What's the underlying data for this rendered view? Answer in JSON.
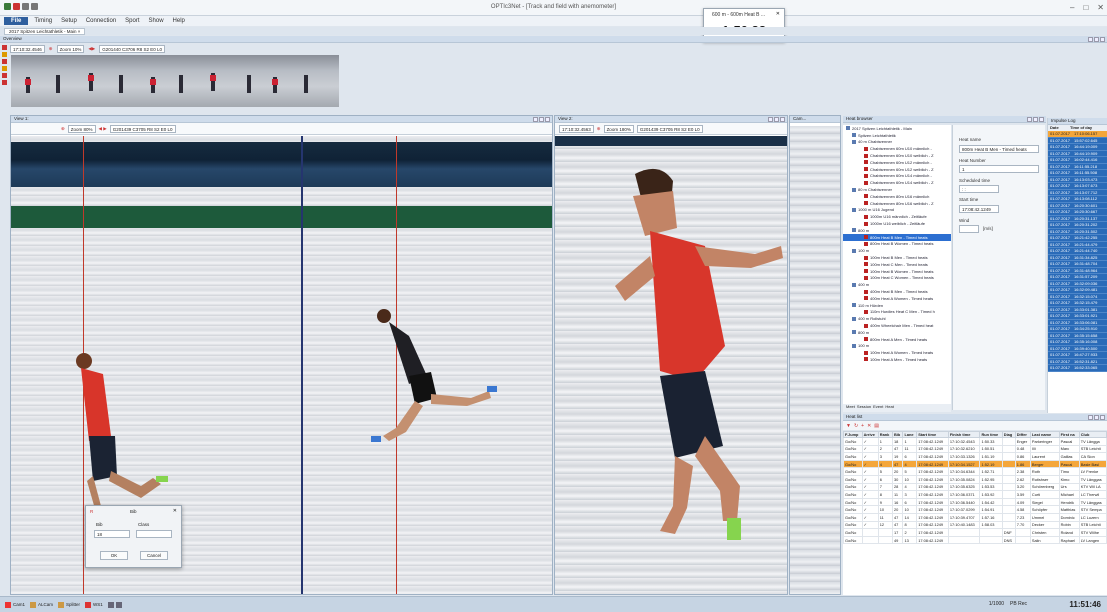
{
  "window": {
    "title": "OPTIc3Net - [Track and field with anemometer]",
    "controls": [
      "–",
      "□",
      "✕"
    ]
  },
  "menu": [
    "File",
    "Timing",
    "Setup",
    "Connection",
    "Sport",
    "Show",
    "Help"
  ],
  "countdown": {
    "title": "600 m - 600m Heat B ...",
    "close": "✕",
    "time": "1:50.33"
  },
  "doc_tab": "2017 Spitzen Leichtathletik - Main  ×",
  "overview": {
    "header": "Overview",
    "time": "17:10:32.4546",
    "zoom": "Zoom 10%",
    "code": "G201440 C3706 R8 S2 E0 L0"
  },
  "view1": {
    "header": "View 1:",
    "zoom": "Zoom 80%",
    "code": "G201439 C3705 R8 S2 E0 L0"
  },
  "view2": {
    "header": "View 2:",
    "time": "17:10:32.4563",
    "zoom": "Zoom 180%",
    "code": "G201439 C3705 R8 S2 E0 L0"
  },
  "cam_label": "Cam...",
  "heat_browser": {
    "header": "Heat browser",
    "items": [
      {
        "label": "2017 Spitzen Leichtathletik - Main",
        "indent": 0
      },
      {
        "label": "Spitzen Leichtathletik",
        "indent": 1
      },
      {
        "label": "40 m Chabisrenner",
        "indent": 1
      },
      {
        "label": "Chabisrennen 60m U10 männlich -",
        "indent": 3
      },
      {
        "label": "Chabisrennen 60m U10 weiblich - Z",
        "indent": 3
      },
      {
        "label": "Chabisrennen 60m U12 männlich -",
        "indent": 3
      },
      {
        "label": "Chabisrennen 60m U12 weiblich - Z",
        "indent": 3
      },
      {
        "label": "Chabisrennen 60m U14 männlich -",
        "indent": 3
      },
      {
        "label": "Chabisrennen 60m U14 weiblich - Z",
        "indent": 3
      },
      {
        "label": "80 m Chabisrenner",
        "indent": 1
      },
      {
        "label": "Chabisrennen 80m U16 männlich",
        "indent": 3
      },
      {
        "label": "Chabisrennen 80m U16 weiblich - Z",
        "indent": 3
      },
      {
        "label": "1000 m U16 Jugend",
        "indent": 1
      },
      {
        "label": "1000m U16 männlich - Zeitläufe",
        "indent": 3
      },
      {
        "label": "1000m U16 weiblich - Zeitläufe",
        "indent": 3
      },
      {
        "label": "800 m",
        "indent": 1
      },
      {
        "label": "800m Heat B Men - Timed heats",
        "indent": 3,
        "selected": true
      },
      {
        "label": "800m Heat B Women - Timed heats",
        "indent": 3
      },
      {
        "label": "100 m",
        "indent": 1
      },
      {
        "label": "100m Heat B Men - Timed heats",
        "indent": 3
      },
      {
        "label": "100m Heat C Men - Timed heats",
        "indent": 3
      },
      {
        "label": "100m Heat B Women - Timed heats",
        "indent": 3
      },
      {
        "label": "100m Heat C Women - Timed heats",
        "indent": 3
      },
      {
        "label": "400 m",
        "indent": 1
      },
      {
        "label": "400m Heat B Men - Timed heats",
        "indent": 3
      },
      {
        "label": "400m Heat A Women - Timed heats",
        "indent": 3
      },
      {
        "label": "110 m Hürden",
        "indent": 1
      },
      {
        "label": "110m Hurdles Heat C Men - Timed h",
        "indent": 3
      },
      {
        "label": "400 m Rollstuhl",
        "indent": 1
      },
      {
        "label": "400m Wheelchair Men - Timed heat",
        "indent": 3
      },
      {
        "label": "800 m",
        "indent": 1
      },
      {
        "label": "800m Heat A Men - Timed heats",
        "indent": 3
      },
      {
        "label": "100 m",
        "indent": 1
      },
      {
        "label": "100m Heat A Women - Timed heats",
        "indent": 3
      },
      {
        "label": "100m Heat A Men - Timed heats",
        "indent": 3
      }
    ],
    "bottom_tabs": [
      "Meet",
      "Session",
      "Event",
      "Heat"
    ]
  },
  "heat_props": {
    "heat_name_label": "Heat name",
    "heat_name": "800m Heat B Men - Timed heats",
    "heat_number_label": "Heat Number",
    "heat_number": "1",
    "scheduled_label": "Scheduled time",
    "scheduled": ": :",
    "start_label": "Start time",
    "start": "17:08:42.1249",
    "wind_label": "Wind",
    "wind_unit": "[m/s]"
  },
  "impulse_log": {
    "header": "Impulse Log",
    "col_date": "Date",
    "col_time": "Time of day",
    "rows": [
      {
        "date": "01.07.2017",
        "time": "17:10:06.157",
        "highlight": true
      },
      {
        "date": "01.07.2017",
        "time": "15:57:02.645"
      },
      {
        "date": "01.07.2017",
        "time": "16:44:19.009"
      },
      {
        "date": "01.07.2017",
        "time": "16:44:19.909"
      },
      {
        "date": "01.07.2017",
        "time": "16:02:44.416"
      },
      {
        "date": "01.07.2017",
        "time": "16:11:55.218"
      },
      {
        "date": "01.07.2017",
        "time": "16:11:55.508"
      },
      {
        "date": "01.07.2017",
        "time": "16:13:03.473"
      },
      {
        "date": "01.07.2017",
        "time": "16:13:07.673"
      },
      {
        "date": "01.07.2017",
        "time": "16:13:07.712"
      },
      {
        "date": "01.07.2017",
        "time": "16:13:08.112"
      },
      {
        "date": "01.07.2017",
        "time": "16:20:30.601"
      },
      {
        "date": "01.07.2017",
        "time": "16:20:30.667"
      },
      {
        "date": "01.07.2017",
        "time": "16:20:31.137"
      },
      {
        "date": "01.07.2017",
        "time": "16:20:31.202"
      },
      {
        "date": "01.07.2017",
        "time": "16:20:31.502"
      },
      {
        "date": "01.07.2017",
        "time": "16:21:42.255"
      },
      {
        "date": "01.07.2017",
        "time": "16:21:44.479"
      },
      {
        "date": "01.07.2017",
        "time": "16:21:44.740"
      },
      {
        "date": "01.07.2017",
        "time": "16:31:34.825"
      },
      {
        "date": "01.07.2017",
        "time": "16:31:48.704"
      },
      {
        "date": "01.07.2017",
        "time": "16:31:48.964"
      },
      {
        "date": "01.07.2017",
        "time": "16:31:57.209"
      },
      {
        "date": "01.07.2017",
        "time": "16:32:09.036"
      },
      {
        "date": "01.07.2017",
        "time": "16:32:09.481"
      },
      {
        "date": "01.07.2017",
        "time": "16:32:15.074"
      },
      {
        "date": "01.07.2017",
        "time": "16:32:15.479"
      },
      {
        "date": "01.07.2017",
        "time": "16:33:01.381"
      },
      {
        "date": "01.07.2017",
        "time": "16:33:01.921"
      },
      {
        "date": "01.07.2017",
        "time": "16:33:06.081"
      },
      {
        "date": "01.07.2017",
        "time": "16:34:25.910"
      },
      {
        "date": "01.07.2017",
        "time": "16:35:15.658"
      },
      {
        "date": "01.07.2017",
        "time": "16:35:16.008"
      },
      {
        "date": "01.07.2017",
        "time": "16:39:40.500"
      },
      {
        "date": "01.07.2017",
        "time": "16:47:27.933"
      },
      {
        "date": "01.07.2017",
        "time": "16:52:31.821"
      },
      {
        "date": "01.07.2017",
        "time": "16:52:33.065"
      }
    ]
  },
  "heat_list": {
    "header": "Heat list",
    "columns": [
      "F.Jump",
      "Arrive",
      "Rank",
      "Bib",
      "Lane",
      "Start time",
      "Finish time",
      "Run time",
      "Diag",
      "Differ",
      "Last name",
      "First na",
      "Club"
    ],
    "rows": [
      [
        "Go/No",
        "✓",
        "1",
        "18",
        "1",
        "17:08:42.1249",
        "17:10:32.4543",
        "1:50.33",
        "",
        "Enger",
        "Parkeringer",
        "Pascal",
        "TV Längga"
      ],
      [
        "Go/No",
        "✓",
        "2",
        "47",
        "11",
        "17:08:42.1249",
        "17:10:32.6210",
        "1:50.51",
        "",
        "0.48",
        "Illi",
        "Marc",
        "STB Leichti"
      ],
      [
        "Go/No",
        "✓",
        "3",
        "19",
        "6",
        "17:08:42.1249",
        "17:10:33.1326",
        "1:51.19",
        "",
        "0.86",
        "Laurent",
        "Gaillas",
        "CA Sion"
      ],
      [
        "Go/No",
        "✓",
        "4",
        "47",
        "4",
        "17:08:42.1249",
        "17:10:34.1527",
        "1:52.19",
        "",
        "1.86",
        "Berger",
        "Pascal",
        "Basle Basl"
      ],
      [
        "Go/No",
        "✓",
        "5",
        "20",
        "5",
        "17:08:42.1249",
        "17:10:34.6344",
        "1:52.71",
        "",
        "2.38",
        "Roth",
        "Timo",
        "LV Frenke"
      ],
      [
        "Go/No",
        "✓",
        "6",
        "30",
        "10",
        "17:08:42.1249",
        "17:10:35.0824",
        "1:52.95",
        "",
        "2.62",
        "Rutishser",
        "Kimo",
        "TV Länggas"
      ],
      [
        "Go/No",
        "✓",
        "7",
        "28",
        "4",
        "17:08:42.1249",
        "17:10:35.6325",
        "1:53.53",
        "",
        "3.20",
        "Schörenberg",
        "Urs",
        "KTV Wil LA"
      ],
      [
        "Go/No",
        "✓",
        "8",
        "11",
        "3",
        "17:08:42.1249",
        "17:10:36.0371",
        "1:53.92",
        "",
        "3.59",
        "Curti",
        "Michael",
        "LC Therwil"
      ],
      [
        "Go/No",
        "✓",
        "9",
        "16",
        "6",
        "17:08:42.1249",
        "17:10:36.5440",
        "1:54.42",
        "",
        "4.09",
        "Siegel",
        "Hendrik",
        "TV Länggas"
      ],
      [
        "Go/No",
        "✓",
        "10",
        "20",
        "10",
        "17:08:42.1249",
        "17:10:37.0299",
        "1:54.91",
        "",
        "4.58",
        "Schöpfer",
        "Matthias",
        "STV Sempa"
      ],
      [
        "Go/No",
        "✓",
        "11",
        "47",
        "14",
        "17:08:42.1249",
        "17:10:39.4707",
        "1:57.16",
        "",
        "7.23",
        "Ummel",
        "Dominic",
        "LC Luzern"
      ],
      [
        "Go/No",
        "✓",
        "12",
        "47",
        "8",
        "17:08:42.1249",
        "17:10:40.1483",
        "1:58.03",
        "",
        "7.70",
        "Decker",
        "Robin",
        "STB Leichti"
      ],
      [
        "Go/No",
        "",
        "",
        "17",
        "2",
        "17:08:42.1249",
        "",
        "",
        "DNF",
        "",
        "Christen",
        "Roland",
        "STV Wilhe"
      ],
      [
        "Go/No",
        "",
        "",
        "49",
        "13",
        "17:08:42.1249",
        "",
        "",
        "DNS",
        "",
        "Salin",
        "Raphael",
        "LV Langen"
      ]
    ]
  },
  "dialog": {
    "title": "Bib",
    "bib_label": "Bib",
    "class_label": "Class",
    "bib_value": "18",
    "ok": "OK",
    "cancel": "Cancel"
  },
  "taskbar": {
    "items": [
      "Cam1",
      "ALCam",
      "Splitter",
      "WS1"
    ],
    "rec_count": "1/1000",
    "rec_label": "PB Rec",
    "clock": "11:51:46"
  },
  "colors": {
    "accent": "#2f5f9e",
    "highlight_row": "#f4a63a",
    "impulse_bg": "#2a6bb8"
  }
}
